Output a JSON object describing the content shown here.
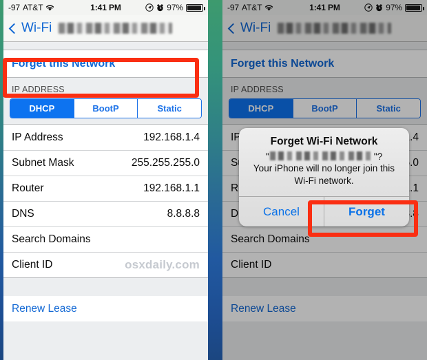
{
  "status_bar": {
    "signal": "-97",
    "carrier": "AT&T",
    "wifi_icon": "wifi-icon",
    "time": "1:41 PM",
    "location_icon": "location-arrow-icon",
    "alarm_icon": "alarm-clock-icon",
    "battery_percent": "97%",
    "battery_icon": "battery-icon"
  },
  "nav": {
    "back_label": "Wi-Fi",
    "back_icon": "chevron-left-icon",
    "title_redacted": ""
  },
  "wifi_settings": {
    "forget_network_label": "Forget this Network",
    "ip_address_header": "IP ADDRESS",
    "segmented": {
      "options": [
        "DHCP",
        "BootP",
        "Static"
      ],
      "selected": "DHCP"
    },
    "rows": [
      {
        "label": "IP Address",
        "value": "192.168.1.4"
      },
      {
        "label": "Subnet Mask",
        "value": "255.255.255.0"
      },
      {
        "label": "Router",
        "value": "192.168.1.1"
      },
      {
        "label": "DNS",
        "value": "8.8.8.8"
      },
      {
        "label": "Search Domains",
        "value": ""
      },
      {
        "label": "Client ID",
        "value": ""
      }
    ],
    "client_id_watermark": "osxdaily.com",
    "renew_lease_label": "Renew Lease"
  },
  "alert": {
    "title": "Forget Wi-Fi Network",
    "ssid_quote_open": "\"",
    "ssid_quote_close": "\"?",
    "message": "Your iPhone will no longer join this Wi-Fi network.",
    "cancel_label": "Cancel",
    "confirm_label": "Forget"
  },
  "annotations": {
    "highlight_color": "#fa2e12",
    "forget_network_box": "Forget this Network",
    "forget_button_box": "Forget"
  },
  "colors": {
    "accent_blue": "#1268d4",
    "segment_active": "#0d73f0",
    "highlight_red": "#fa2e12",
    "background_gradient_top": "#3d9a6e",
    "background_gradient_bottom": "#1b4680"
  }
}
